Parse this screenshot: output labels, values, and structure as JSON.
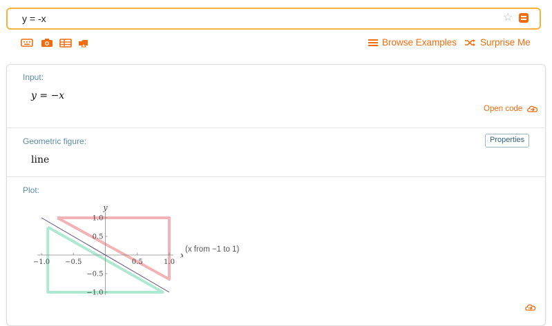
{
  "search": {
    "query": "y = -x"
  },
  "toolbar": {
    "icons": [
      "keyboard-icon",
      "camera-icon",
      "table-icon",
      "upload-icon"
    ],
    "browse_label": "Browse Examples",
    "surprise_label": "Surprise Me"
  },
  "pods": {
    "input": {
      "title": "Input:",
      "lhs": "y",
      "eq": "=",
      "rhs": "−x",
      "open_code": "Open code"
    },
    "geometric": {
      "title": "Geometric figure:",
      "value": "line",
      "properties_label": "Properties"
    },
    "plot": {
      "title": "Plot:",
      "note": "(x from −1 to 1)"
    }
  },
  "chart_data": {
    "type": "line",
    "xlabel": "x",
    "ylabel": "y",
    "xlim": [
      -1.0,
      1.0
    ],
    "ylim": [
      -1.0,
      1.0
    ],
    "x_ticks": [
      "−1.0",
      "−0.5",
      "0.5",
      "1.0"
    ],
    "y_ticks": [
      "1.0",
      "0.5",
      "−0.5",
      "−1.0"
    ],
    "series": [
      {
        "x": [
          -1.0,
          1.0
        ],
        "y": [
          1.0,
          -1.0
        ]
      }
    ],
    "annotations": [
      {
        "x": [
          -0.75,
          1.0,
          1.0,
          -0.75
        ],
        "y": [
          1.0,
          1.0,
          -0.65,
          1.0
        ],
        "color": "#f3b2b5"
      },
      {
        "x": [
          -0.9,
          -0.9,
          0.9,
          -0.9
        ],
        "y": [
          0.75,
          -1.0,
          -1.0,
          0.75
        ],
        "color": "#aee9d2"
      }
    ],
    "colors": {
      "line": "#5b4a8b",
      "axis": "#888888"
    }
  }
}
